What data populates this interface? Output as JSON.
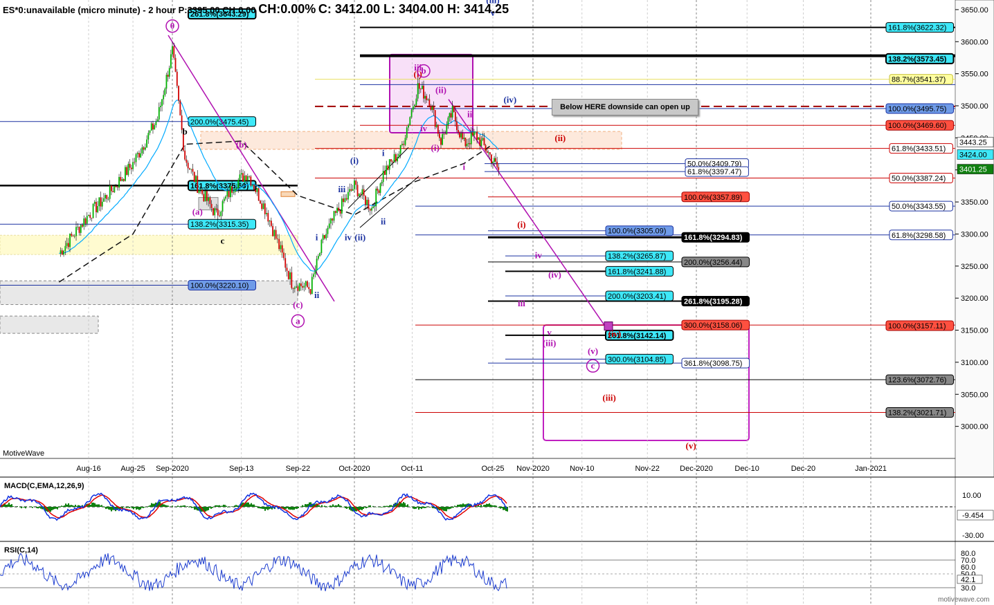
{
  "header": {
    "symbol": "ES*0:unavailable (micro minute) - 2 hour",
    "p": "P:3395.00",
    "ch0": "CH:0.00",
    "chpct": "CH:0.00%",
    "ohlc": "C: 3412.00  L: 3404.00  H: 3414.25"
  },
  "banner": "Below HERE downside can open up",
  "branding": {
    "left": "MotiveWave",
    "right": "motivewave.com"
  },
  "panels": {
    "macd_label": "MACD(C,EMA,12,26,9)",
    "rsi_label": "RSI(C,14)"
  },
  "colors": {
    "bullCandle": "#00b000",
    "bearCandle": "#d00000",
    "wick": "#000000",
    "sma": "#111111",
    "ema": "#00aaff",
    "wavePurple": "#b010b0",
    "waveBlue": "#1a30a0",
    "waveRed": "#cc0000",
    "macdLine": "#1030e0",
    "signalLine": "#e00000",
    "hist": "#108010",
    "rsiLine": "#1f3fd0",
    "rsiFill": "#30c030"
  },
  "chart_data": {
    "type": "line",
    "title": "ES*0 2 hour",
    "x_ticks": [
      "Aug-16",
      "Aug-25",
      "Sep-2020",
      "Sep-13",
      "Sep-22",
      "Oct-2020",
      "Oct-11",
      "Oct-25",
      "Nov-2020",
      "Nov-10",
      "Nov-22",
      "Dec-2020",
      "Dec-10",
      "Dec-20",
      "Jan-2021"
    ],
    "y_ticks": [
      3000,
      3050,
      3100,
      3150,
      3200,
      3250,
      3300,
      3350,
      3400,
      3450,
      3500,
      3550,
      3600,
      3650
    ],
    "ylim": [
      2950,
      3665
    ],
    "current_price": "3401.25",
    "last_high": "3443.25",
    "last_open": "3424.00",
    "price_path": [
      [
        "Aug-10",
        3270
      ],
      [
        "Aug-16",
        3330
      ],
      [
        "Aug-20",
        3362
      ],
      [
        "Aug-25",
        3410
      ],
      [
        "Aug-30",
        3480
      ],
      [
        "Sep-02",
        3585
      ],
      [
        "Sep-04",
        3420
      ],
      [
        "Sep-06",
        3375
      ],
      [
        "Sep-09",
        3330
      ],
      [
        "Sep-12",
        3380
      ],
      [
        "Sep-14",
        3395
      ],
      [
        "Sep-17",
        3335
      ],
      [
        "Sep-21",
        3225
      ],
      [
        "Sep-24",
        3215
      ],
      [
        "Sep-26",
        3290
      ],
      [
        "Sep-28",
        3330
      ],
      [
        "Oct-01",
        3375
      ],
      [
        "Oct-04",
        3340
      ],
      [
        "Oct-06",
        3395
      ],
      [
        "Oct-09",
        3430
      ],
      [
        "Oct-12",
        3530
      ],
      [
        "Oct-14",
        3510
      ],
      [
        "Oct-16",
        3445
      ],
      [
        "Oct-18",
        3490
      ],
      [
        "Oct-20",
        3440
      ],
      [
        "Oct-22",
        3455
      ],
      [
        "Oct-24",
        3430
      ],
      [
        "Oct-26",
        3400
      ]
    ],
    "sma_path": [
      [
        "Aug-10",
        3225
      ],
      [
        "Aug-25",
        3300
      ],
      [
        "Sep-04",
        3440
      ],
      [
        "Sep-13",
        3445
      ],
      [
        "Sep-22",
        3360
      ],
      [
        "Oct-01",
        3330
      ],
      [
        "Oct-11",
        3380
      ],
      [
        "Oct-20",
        3410
      ],
      [
        "Oct-25",
        3440
      ]
    ],
    "fib_levels": [
      {
        "label": "261.8%(3643.29)",
        "value": 3643.29,
        "style": "cyan-bold"
      },
      {
        "label": "161.8%(3622.32)",
        "value": 3622.32,
        "style": "cyan"
      },
      {
        "label": "138.2%(3573.45)",
        "value": 3573.45,
        "style": "cyan-bold"
      },
      {
        "label": "88.7%(3541.37)",
        "value": 3541.37,
        "style": "yellow"
      },
      {
        "label": "100.0%(3495.75)",
        "value": 3495.75,
        "style": "blue"
      },
      {
        "label": "100.0%(3469.60)",
        "value": 3469.6,
        "style": "red"
      },
      {
        "label": "200.0%(3475.45)",
        "value": 3475.45,
        "style": "cyan"
      },
      {
        "label": "61.8%(3433.51)",
        "value": 3433.51,
        "style": "red-outline"
      },
      {
        "label": "50.0%(3409.79)",
        "value": 3409.79,
        "style": "blue-outline"
      },
      {
        "label": "61.8%(3397.47)",
        "value": 3397.47,
        "style": "blue-outline"
      },
      {
        "label": "50.0%(3387.24)",
        "value": 3387.24,
        "style": "red-outline"
      },
      {
        "label": "161.8%(3375.60)",
        "value": 3375.6,
        "style": "cyan-bold"
      },
      {
        "label": "100.0%(3357.89)",
        "value": 3357.89,
        "style": "red"
      },
      {
        "label": "50.0%(3343.55)",
        "value": 3343.55,
        "style": "blue-outline"
      },
      {
        "label": "138.2%(3315.35)",
        "value": 3315.35,
        "style": "cyan"
      },
      {
        "label": "100.0%(3305.09)",
        "value": 3305.09,
        "style": "blue"
      },
      {
        "label": "61.8%(3298.58)",
        "value": 3298.58,
        "style": "blue-outline"
      },
      {
        "label": "161.8%(3294.83)",
        "value": 3294.83,
        "style": "black"
      },
      {
        "label": "138.2%(3265.87)",
        "value": 3265.87,
        "style": "cyan"
      },
      {
        "label": "200.0%(3256.44)",
        "value": 3256.44,
        "style": "gray"
      },
      {
        "label": "161.8%(3241.88)",
        "value": 3241.88,
        "style": "cyan"
      },
      {
        "label": "100.0%(3220.10)",
        "value": 3220.1,
        "style": "blue"
      },
      {
        "label": "200.0%(3203.41)",
        "value": 3203.41,
        "style": "cyan"
      },
      {
        "label": "261.8%(3195.28)",
        "value": 3195.28,
        "style": "black"
      },
      {
        "label": "300.0%(3158.06)",
        "value": 3158.06,
        "style": "red"
      },
      {
        "label": "100.0%(3157.11)",
        "value": 3157.11,
        "style": "red"
      },
      {
        "label": "261.8%(3142.14)",
        "value": 3142.14,
        "style": "cyan-bold"
      },
      {
        "label": "300.0%(3104.85)",
        "value": 3104.85,
        "style": "cyan"
      },
      {
        "label": "361.8%(3098.75)",
        "value": 3098.75,
        "style": "blue-outline"
      },
      {
        "label": "123.6%(3072.76)",
        "value": 3072.76,
        "style": "gray"
      },
      {
        "label": "138.2%(3021.71)",
        "value": 3021.71,
        "style": "gray"
      }
    ],
    "wave_labels": [
      {
        "t": "0",
        "d": "Sep-02",
        "p": 3620,
        "c": "#b010b0",
        "circle": true
      },
      {
        "t": "b",
        "d": "Sep-04",
        "p": 3455,
        "c": "#000"
      },
      {
        "t": "(a)",
        "d": "Sep-06",
        "p": 3330,
        "c": "#b010b0"
      },
      {
        "t": "c",
        "d": "Sep-10",
        "p": 3285,
        "c": "#000"
      },
      {
        "t": "(b)",
        "d": "Sep-13",
        "p": 3435,
        "c": "#b010b0"
      },
      {
        "t": "(c)",
        "d": "Sep-22",
        "p": 3185,
        "c": "#b010b0"
      },
      {
        "t": "a",
        "d": "Sep-22",
        "p": 3160,
        "c": "#b010b0",
        "circle": true
      },
      {
        "t": "i",
        "d": "Sep-25",
        "p": 3290,
        "c": "#1a30a0"
      },
      {
        "t": "ii",
        "d": "Sep-25",
        "p": 3200,
        "c": "#1a30a0"
      },
      {
        "t": "iii",
        "d": "Sep-29",
        "p": 3365,
        "c": "#1a30a0"
      },
      {
        "t": "iv",
        "d": "Sep-30",
        "p": 3290,
        "c": "#1a30a0"
      },
      {
        "t": "(i)",
        "d": "Oct-01",
        "p": 3410,
        "c": "#1a30a0"
      },
      {
        "t": "(ii)",
        "d": "Oct-02",
        "p": 3290,
        "c": "#1a30a0"
      },
      {
        "t": "i",
        "d": "Oct-06",
        "p": 3422,
        "c": "#1a30a0"
      },
      {
        "t": "ii",
        "d": "Oct-06",
        "p": 3315,
        "c": "#1a30a0"
      },
      {
        "t": "iii",
        "d": "Oct-12",
        "p": 3555,
        "c": "#b010b0"
      },
      {
        "t": "(i)",
        "d": "Oct-12",
        "p": 3545,
        "c": "#cc0000"
      },
      {
        "t": "b",
        "d": "Oct-13",
        "p": 3550,
        "c": "#b010b0",
        "circle": true
      },
      {
        "t": "iv",
        "d": "Oct-13",
        "p": 3460,
        "c": "#b010b0"
      },
      {
        "t": "(ii)",
        "d": "Oct-16",
        "p": 3520,
        "c": "#b010b0"
      },
      {
        "t": "(i)",
        "d": "Oct-15",
        "p": 3430,
        "c": "#b010b0"
      },
      {
        "t": "ii",
        "d": "Oct-21",
        "p": 3482,
        "c": "#b010b0"
      },
      {
        "t": "i",
        "d": "Oct-20",
        "p": 3400,
        "c": "#b010b0"
      },
      {
        "t": "(iv)",
        "d": "Oct-28",
        "p": 3505,
        "c": "#1a30a0"
      },
      {
        "t": "(iii)",
        "d": "Oct-25",
        "p": 3660,
        "c": "#1a30a0"
      },
      {
        "t": "v",
        "d": "Oct-25",
        "p": 3640,
        "c": "#1a30a0"
      },
      {
        "t": "(ii)",
        "d": "Nov-06",
        "p": 3445,
        "c": "#cc0000"
      },
      {
        "t": "(i)",
        "d": "Oct-30",
        "p": 3310,
        "c": "#cc0000"
      },
      {
        "t": "iv",
        "d": "Nov-02",
        "p": 3262,
        "c": "#b010b0"
      },
      {
        "t": "(iv)",
        "d": "Nov-05",
        "p": 3232,
        "c": "#b010b0"
      },
      {
        "t": "iii",
        "d": "Oct-30",
        "p": 3187,
        "c": "#b010b0"
      },
      {
        "t": "v",
        "d": "Nov-04",
        "p": 3142,
        "c": "#b010b0"
      },
      {
        "t": "(iii)",
        "d": "Nov-04",
        "p": 3125,
        "c": "#b010b0"
      },
      {
        "t": "(v)",
        "d": "Nov-12",
        "p": 3113,
        "c": "#b010b0"
      },
      {
        "t": "c",
        "d": "Nov-12",
        "p": 3090,
        "c": "#b010b0",
        "circle": true
      },
      {
        "t": "(iv)",
        "d": "Nov-16",
        "p": 3140,
        "c": "#cc0000"
      },
      {
        "t": "(iii)",
        "d": "Nov-15",
        "p": 3040,
        "c": "#cc0000"
      },
      {
        "t": "(v)",
        "d": "Nov-30",
        "p": 2965,
        "c": "#cc0000"
      }
    ],
    "macd": {
      "label": "MACD(C,EMA,12,26,9)",
      "ticks": [
        "10.00",
        "-9.454",
        "-30.00"
      ]
    },
    "rsi": {
      "label": "RSI(C,14)",
      "ticks": [
        "80.0",
        "70.0",
        "60.0",
        "50.0",
        "42.1",
        "30.0"
      ]
    }
  }
}
